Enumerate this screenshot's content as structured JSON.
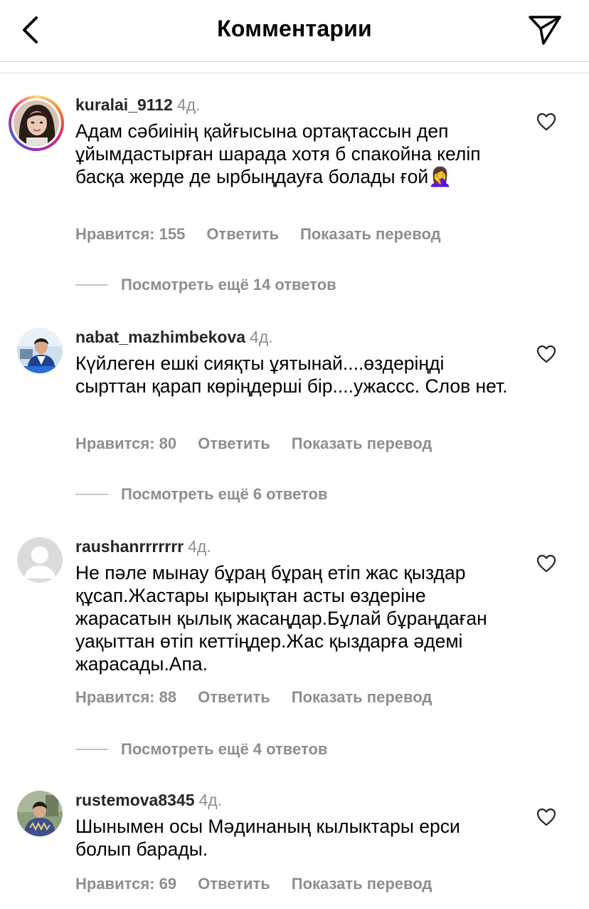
{
  "header": {
    "title": "Комментарии"
  },
  "comments": [
    {
      "username": "kuralai_9112",
      "time": "4д.",
      "text": "Адам сәбиінің қайғысына ортақтассын деп ұйымдастырған шарада хотя б спакойна келіп басқа жерде де ырбыңдауға болады ғой🤦‍♀️",
      "likes": "Нравится: 155",
      "reply": "Ответить",
      "translate": "Показать перевод",
      "more": "Посмотреть ещё 14 ответов"
    },
    {
      "username": "nabat_mazhimbekova",
      "time": "4д.",
      "text": "Күйлеген ешкі сияқты ұятынай....өздеріңді сырттан қарап көріңдерші бір....ужассс. Слов нет.",
      "likes": "Нравится: 80",
      "reply": "Ответить",
      "translate": "Показать перевод",
      "more": "Посмотреть ещё 6 ответов"
    },
    {
      "username": "raushanrrrrrrr",
      "time": "4д.",
      "text": "Не пәле мынау бұраң бұраң етіп жас қыздар құсап.Жастары қырықтан асты өздеріне жарасатын қылық жасаңдар.Бұлай бұраңдаған уақыттан өтіп кеттіңдер.Жас қыздарға әдемі жарасады.Апа.",
      "likes": "Нравится: 88",
      "reply": "Ответить",
      "translate": "Показать перевод",
      "more": "Посмотреть ещё 4 ответов"
    },
    {
      "username": "rustemova8345",
      "time": "4д.",
      "text": "Шынымен осы Мәдинаның кылыктары ерси болып барады.",
      "likes": "Нравится: 69",
      "reply": "Ответить",
      "translate": "Показать перевод"
    }
  ],
  "colors": {
    "username": "#262626",
    "secondary": "#8e8e8e",
    "divider": "#dbdbdb"
  }
}
